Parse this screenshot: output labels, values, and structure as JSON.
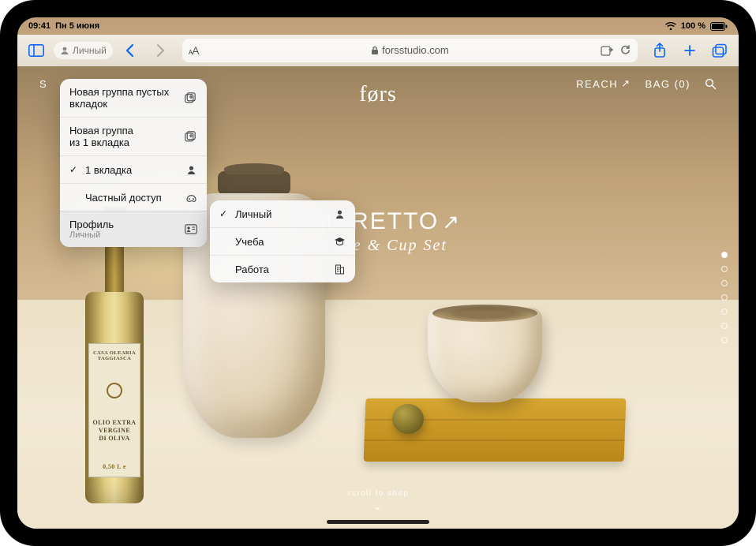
{
  "status": {
    "time": "09:41",
    "date": "Пн 5 июня",
    "battery_pct": "100 %"
  },
  "toolbar": {
    "profile_label": "Личный",
    "aa_label": "AA",
    "url_host": "forsstudio.com"
  },
  "tab_menu": {
    "new_empty_group_line1": "Новая группа пустых",
    "new_empty_group_line2": "вкладок",
    "new_group_from_line1": "Новая группа",
    "new_group_from_line2": "из 1 вкладка",
    "one_tab": "1 вкладка",
    "private": "Частный доступ",
    "profile_label": "Профиль",
    "profile_value": "Личный"
  },
  "profile_menu": {
    "items": [
      {
        "label": "Личный",
        "checked": true,
        "icon": "person"
      },
      {
        "label": "Учеба",
        "checked": false,
        "icon": "graduation"
      },
      {
        "label": "Работа",
        "checked": false,
        "icon": "building"
      }
    ]
  },
  "site": {
    "nav_left": "S",
    "logo": "førs",
    "reach": "REACH",
    "bag": "BAG (0)",
    "hero_line1": "AMARETTO",
    "hero_line2": "Carafe & Cup Set",
    "scroll_hint": "scroll to shop"
  },
  "bottle_label": {
    "brand": "CASA OLEARIA TAGGIASCA",
    "main1": "OLIO EXTRA",
    "main2": "VERGINE",
    "main3": "DI OLIVA",
    "vol": "0,50 L e"
  }
}
